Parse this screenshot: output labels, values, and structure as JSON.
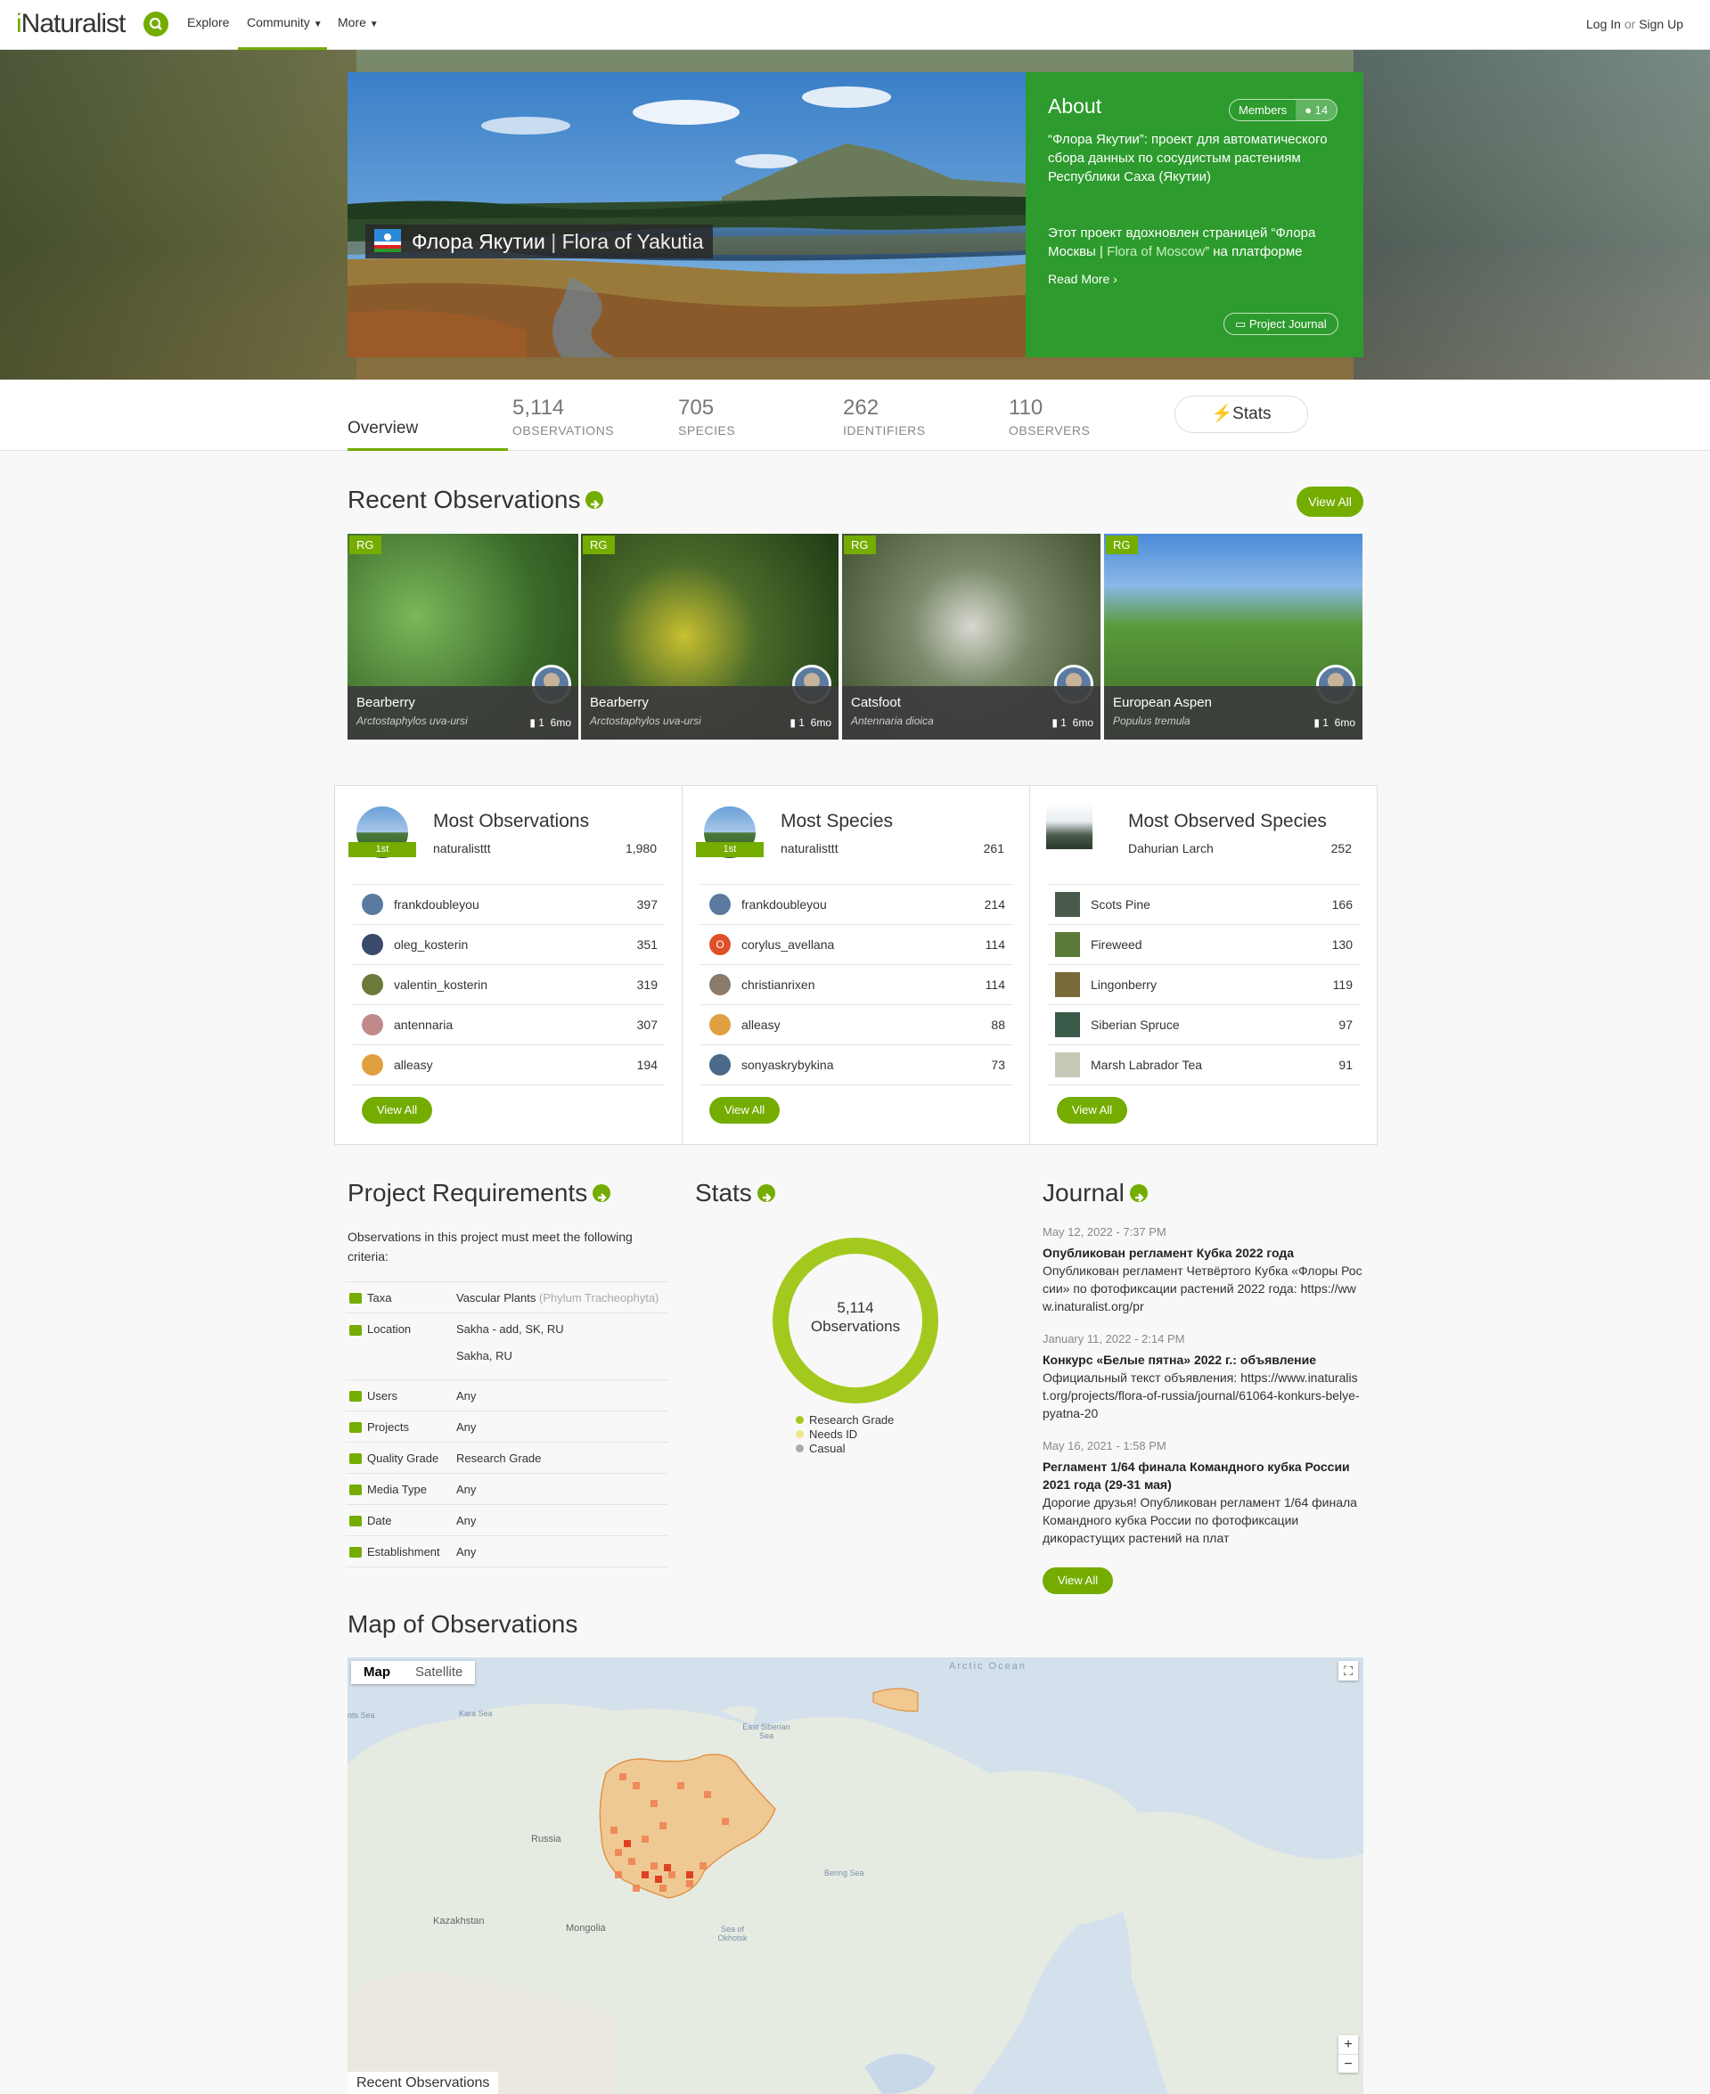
{
  "header": {
    "logo_i": "i",
    "logo_rest": "Naturalist",
    "nav": [
      "Explore",
      "Community",
      "More"
    ],
    "login": "Log In",
    "or": "or",
    "signup": "Sign Up"
  },
  "hero": {
    "title_ru": "Флора Якутии",
    "title_sep": " | ",
    "title_en": "Flora of Yakutia"
  },
  "about": {
    "heading": "About",
    "members_label": "Members",
    "members_count": "14",
    "para1": "“Флора Якутии”: проект для автоматического сбора данных по сосудистым растениям Республики Саха (Якутии)",
    "para2_a": "Этот проект вдохновлен страницей “Флора Москвы | ",
    "para2_link": "Flora of Moscow",
    "para2_b": "” на платформе",
    "read_more": "Read More",
    "journal_btn": "Project Journal"
  },
  "stats": {
    "overview": "Overview",
    "items": [
      {
        "num": "5,114",
        "label": "OBSERVATIONS"
      },
      {
        "num": "705",
        "label": "SPECIES"
      },
      {
        "num": "262",
        "label": "IDENTIFIERS"
      },
      {
        "num": "110",
        "label": "OBSERVERS"
      }
    ],
    "stats_btn": "Stats"
  },
  "recent": {
    "heading": "Recent Observations",
    "view_all": "View All",
    "items": [
      {
        "badge": "RG",
        "name": "Bearberry",
        "sci": "Arctostaphylos uva-ursi",
        "ids": "1",
        "age": "6mo"
      },
      {
        "badge": "RG",
        "name": "Bearberry",
        "sci": "Arctostaphylos uva-ursi",
        "ids": "1",
        "age": "6mo"
      },
      {
        "badge": "RG",
        "name": "Catsfoot",
        "sci": "Antennaria dioica",
        "ids": "1",
        "age": "6mo"
      },
      {
        "badge": "RG",
        "name": "European Aspen",
        "sci": "Populus tremula",
        "ids": "1",
        "age": "6mo"
      }
    ]
  },
  "leaders": {
    "most_obs": {
      "heading": "Most Observations",
      "top_name": "naturalisttt",
      "top_count": "1,980",
      "rank": "1st",
      "rows": [
        {
          "name": "frankdoubleyou",
          "count": "397",
          "color": "#5a7aa0"
        },
        {
          "name": "oleg_kosterin",
          "count": "351",
          "color": "#3a4a6a"
        },
        {
          "name": "valentin_kosterin",
          "count": "319",
          "color": "#6a7a3a"
        },
        {
          "name": "antennaria",
          "count": "307",
          "color": "#c08a8a"
        },
        {
          "name": "alleasy",
          "count": "194",
          "color": "#e0a040"
        }
      ]
    },
    "most_species": {
      "heading": "Most Species",
      "top_name": "naturalisttt",
      "top_count": "261",
      "rank": "1st",
      "rows": [
        {
          "name": "frankdoubleyou",
          "count": "214",
          "color": "#5a7aa0"
        },
        {
          "name": "corylus_avellana",
          "count": "114",
          "color": "#e0502a",
          "letter": "O"
        },
        {
          "name": "christianrixen",
          "count": "114",
          "color": "#8a7a6a"
        },
        {
          "name": "alleasy",
          "count": "88",
          "color": "#e0a040"
        },
        {
          "name": "sonyaskrybykina",
          "count": "73",
          "color": "#4a6a8a"
        }
      ]
    },
    "most_observed": {
      "heading": "Most Observed Species",
      "top_name": "Dahurian Larch",
      "top_count": "252",
      "rows": [
        {
          "name": "Scots Pine",
          "count": "166",
          "color": "#4a5a4a"
        },
        {
          "name": "Fireweed",
          "count": "130",
          "color": "#5a7a3a"
        },
        {
          "name": "Lingonberry",
          "count": "119",
          "color": "#7a6a3a"
        },
        {
          "name": "Siberian Spruce",
          "count": "97",
          "color": "#3a5a4a"
        },
        {
          "name": "Marsh Labrador Tea",
          "count": "91",
          "color": "#c8c8b8"
        }
      ]
    },
    "view_all": "View All"
  },
  "requirements": {
    "heading": "Project Requirements",
    "intro": "Observations in this project must meet the following criteria:",
    "rows": [
      {
        "key": "Taxa",
        "val": "Vascular Plants",
        "val2": "(Phylum Tracheophyta)"
      },
      {
        "key": "Location",
        "val": "Sakha - add, SK, RU",
        "val3": "Sakha, RU"
      },
      {
        "key": "Users",
        "val": "Any"
      },
      {
        "key": "Projects",
        "val": "Any"
      },
      {
        "key": "Quality Grade",
        "val": "Research Grade"
      },
      {
        "key": "Media Type",
        "val": "Any"
      },
      {
        "key": "Date",
        "val": "Any"
      },
      {
        "key": "Establishment",
        "val": "Any"
      }
    ]
  },
  "stats_section": {
    "heading": "Stats",
    "center_num": "5,114",
    "center_label": "Observations",
    "legend": [
      {
        "label": "Research Grade",
        "color": "#a4c91e"
      },
      {
        "label": "Needs ID",
        "color": "#f0e68c"
      },
      {
        "label": "Casual",
        "color": "#aaaaaa"
      }
    ],
    "chart_data": {
      "type": "pie",
      "categories": [
        "Research Grade",
        "Needs ID",
        "Casual"
      ],
      "values": [
        5114,
        0,
        0
      ]
    }
  },
  "journal": {
    "heading": "Journal",
    "posts": [
      {
        "date": "May 12, 2022 - 7:37 PM",
        "title": "Опубликован регламент Кубка 2022 года",
        "body": "Опубликован регламент Четвёртого Кубка «Флоры России» по фотофиксации растений 2022 года: https://www.inaturalist.org/pr"
      },
      {
        "date": "January 11, 2022 - 2:14 PM",
        "title": "Конкурс «Белые пятна» 2022 г.: объявление",
        "body": "Официальный текст объявления: https://www.inaturalist.org/projects/flora-of-russia/journal/61064-konkurs-belye-pyatna-20"
      },
      {
        "date": "May 16, 2021 - 1:58 PM",
        "title": "Регламент 1/64 финала Командного кубка России 2021 года (29-31 мая)",
        "body": "Дорогие друзья! Опубликован регламент 1/64 финала Командного кубка России по фотофиксации дикорастущих растений на плат"
      }
    ],
    "view_all": "View All"
  },
  "map": {
    "heading": "Map of Observations",
    "tab_map": "Map",
    "tab_satellite": "Satellite",
    "labels": [
      "Arctic Ocean",
      "Kara Sea",
      "East Siberian Sea",
      "Russia",
      "Bering Sea",
      "Sea of Okhotsk",
      "Kazakhstan",
      "Mongolia",
      "nts Sea"
    ],
    "zoom_in": "+",
    "zoom_out": "−",
    "recent_tab": "Recent Observations"
  }
}
